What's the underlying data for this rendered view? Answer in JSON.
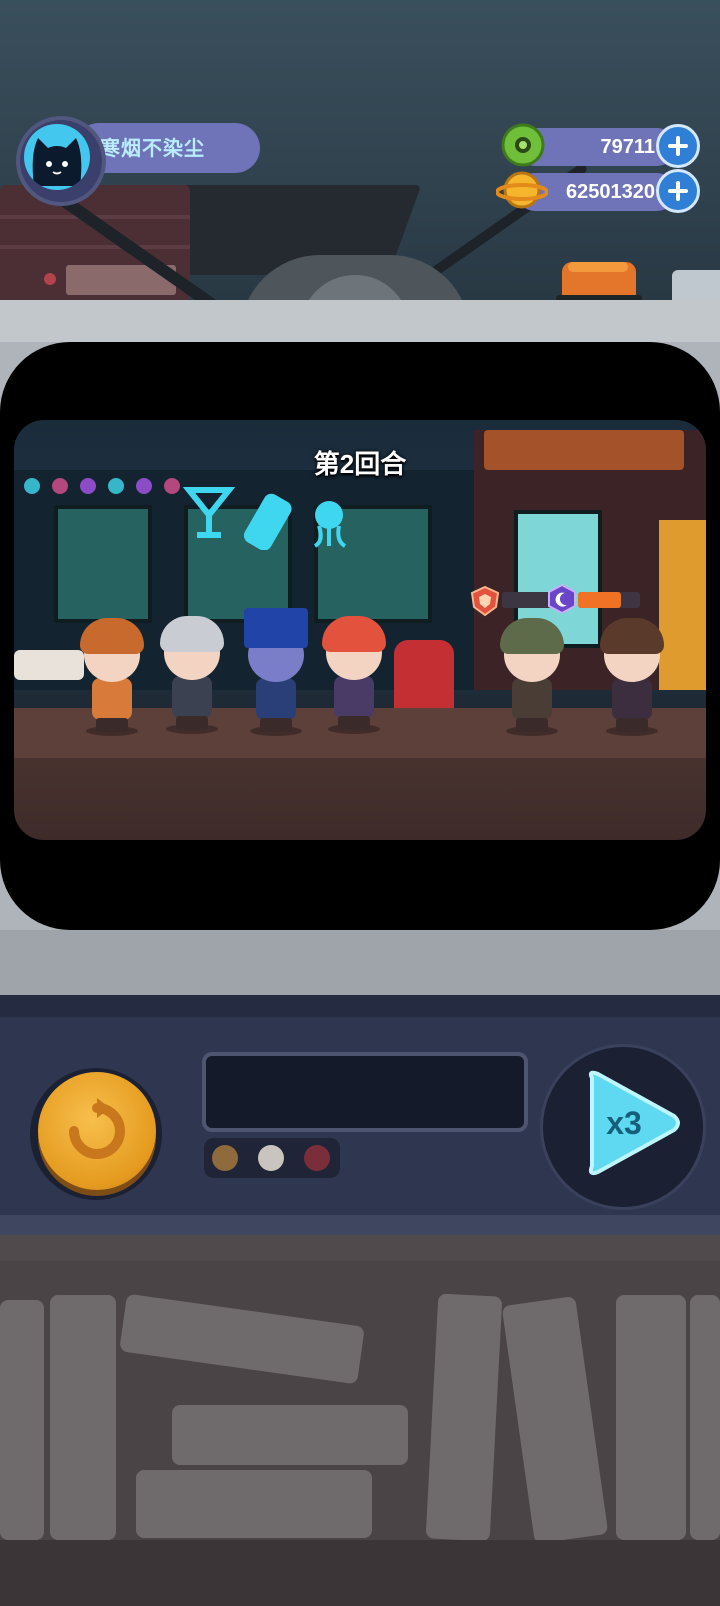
{
  "player": {
    "name": "寒烟不染尘",
    "avatar_icon": "cat-face-icon"
  },
  "resources": {
    "gems": {
      "value": "79711",
      "icon": "green-donut-coin-icon"
    },
    "coins": {
      "value": "62501320",
      "icon": "gold-planet-coin-icon"
    }
  },
  "battle": {
    "round_label": "第2回合"
  },
  "controls": {
    "speed_label": "x3",
    "retry_icon": "retry-icon"
  },
  "colors": {
    "accent_pill": "#6f73b8",
    "name_text": "#b9ecff",
    "retry": "#f3a92c",
    "speed": "#5fd8f2"
  }
}
